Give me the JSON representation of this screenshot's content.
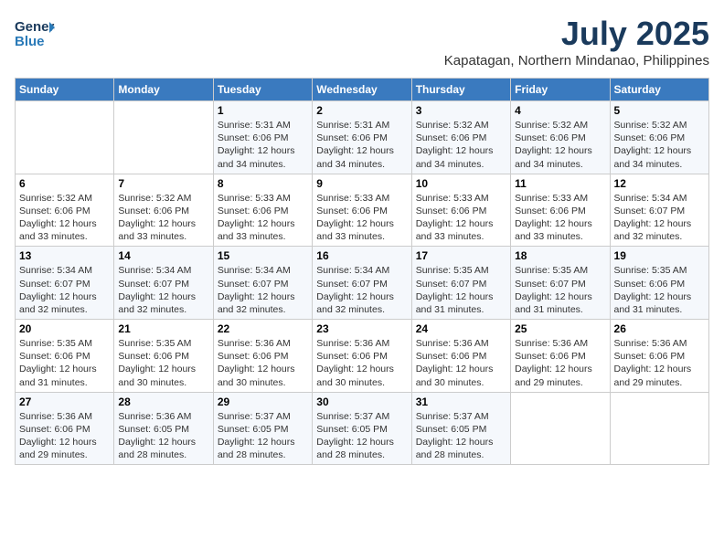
{
  "header": {
    "logo_line1": "General",
    "logo_line2": "Blue",
    "main_title": "July 2025",
    "subtitle": "Kapatagan, Northern Mindanao, Philippines"
  },
  "weekdays": [
    "Sunday",
    "Monday",
    "Tuesday",
    "Wednesday",
    "Thursday",
    "Friday",
    "Saturday"
  ],
  "weeks": [
    [
      {
        "day": "",
        "text": ""
      },
      {
        "day": "",
        "text": ""
      },
      {
        "day": "1",
        "text": "Sunrise: 5:31 AM\nSunset: 6:06 PM\nDaylight: 12 hours and 34 minutes."
      },
      {
        "day": "2",
        "text": "Sunrise: 5:31 AM\nSunset: 6:06 PM\nDaylight: 12 hours and 34 minutes."
      },
      {
        "day": "3",
        "text": "Sunrise: 5:32 AM\nSunset: 6:06 PM\nDaylight: 12 hours and 34 minutes."
      },
      {
        "day": "4",
        "text": "Sunrise: 5:32 AM\nSunset: 6:06 PM\nDaylight: 12 hours and 34 minutes."
      },
      {
        "day": "5",
        "text": "Sunrise: 5:32 AM\nSunset: 6:06 PM\nDaylight: 12 hours and 34 minutes."
      }
    ],
    [
      {
        "day": "6",
        "text": "Sunrise: 5:32 AM\nSunset: 6:06 PM\nDaylight: 12 hours and 33 minutes."
      },
      {
        "day": "7",
        "text": "Sunrise: 5:32 AM\nSunset: 6:06 PM\nDaylight: 12 hours and 33 minutes."
      },
      {
        "day": "8",
        "text": "Sunrise: 5:33 AM\nSunset: 6:06 PM\nDaylight: 12 hours and 33 minutes."
      },
      {
        "day": "9",
        "text": "Sunrise: 5:33 AM\nSunset: 6:06 PM\nDaylight: 12 hours and 33 minutes."
      },
      {
        "day": "10",
        "text": "Sunrise: 5:33 AM\nSunset: 6:06 PM\nDaylight: 12 hours and 33 minutes."
      },
      {
        "day": "11",
        "text": "Sunrise: 5:33 AM\nSunset: 6:06 PM\nDaylight: 12 hours and 33 minutes."
      },
      {
        "day": "12",
        "text": "Sunrise: 5:34 AM\nSunset: 6:07 PM\nDaylight: 12 hours and 32 minutes."
      }
    ],
    [
      {
        "day": "13",
        "text": "Sunrise: 5:34 AM\nSunset: 6:07 PM\nDaylight: 12 hours and 32 minutes."
      },
      {
        "day": "14",
        "text": "Sunrise: 5:34 AM\nSunset: 6:07 PM\nDaylight: 12 hours and 32 minutes."
      },
      {
        "day": "15",
        "text": "Sunrise: 5:34 AM\nSunset: 6:07 PM\nDaylight: 12 hours and 32 minutes."
      },
      {
        "day": "16",
        "text": "Sunrise: 5:34 AM\nSunset: 6:07 PM\nDaylight: 12 hours and 32 minutes."
      },
      {
        "day": "17",
        "text": "Sunrise: 5:35 AM\nSunset: 6:07 PM\nDaylight: 12 hours and 31 minutes."
      },
      {
        "day": "18",
        "text": "Sunrise: 5:35 AM\nSunset: 6:07 PM\nDaylight: 12 hours and 31 minutes."
      },
      {
        "day": "19",
        "text": "Sunrise: 5:35 AM\nSunset: 6:06 PM\nDaylight: 12 hours and 31 minutes."
      }
    ],
    [
      {
        "day": "20",
        "text": "Sunrise: 5:35 AM\nSunset: 6:06 PM\nDaylight: 12 hours and 31 minutes."
      },
      {
        "day": "21",
        "text": "Sunrise: 5:35 AM\nSunset: 6:06 PM\nDaylight: 12 hours and 30 minutes."
      },
      {
        "day": "22",
        "text": "Sunrise: 5:36 AM\nSunset: 6:06 PM\nDaylight: 12 hours and 30 minutes."
      },
      {
        "day": "23",
        "text": "Sunrise: 5:36 AM\nSunset: 6:06 PM\nDaylight: 12 hours and 30 minutes."
      },
      {
        "day": "24",
        "text": "Sunrise: 5:36 AM\nSunset: 6:06 PM\nDaylight: 12 hours and 30 minutes."
      },
      {
        "day": "25",
        "text": "Sunrise: 5:36 AM\nSunset: 6:06 PM\nDaylight: 12 hours and 29 minutes."
      },
      {
        "day": "26",
        "text": "Sunrise: 5:36 AM\nSunset: 6:06 PM\nDaylight: 12 hours and 29 minutes."
      }
    ],
    [
      {
        "day": "27",
        "text": "Sunrise: 5:36 AM\nSunset: 6:06 PM\nDaylight: 12 hours and 29 minutes."
      },
      {
        "day": "28",
        "text": "Sunrise: 5:36 AM\nSunset: 6:05 PM\nDaylight: 12 hours and 28 minutes."
      },
      {
        "day": "29",
        "text": "Sunrise: 5:37 AM\nSunset: 6:05 PM\nDaylight: 12 hours and 28 minutes."
      },
      {
        "day": "30",
        "text": "Sunrise: 5:37 AM\nSunset: 6:05 PM\nDaylight: 12 hours and 28 minutes."
      },
      {
        "day": "31",
        "text": "Sunrise: 5:37 AM\nSunset: 6:05 PM\nDaylight: 12 hours and 28 minutes."
      },
      {
        "day": "",
        "text": ""
      },
      {
        "day": "",
        "text": ""
      }
    ]
  ]
}
